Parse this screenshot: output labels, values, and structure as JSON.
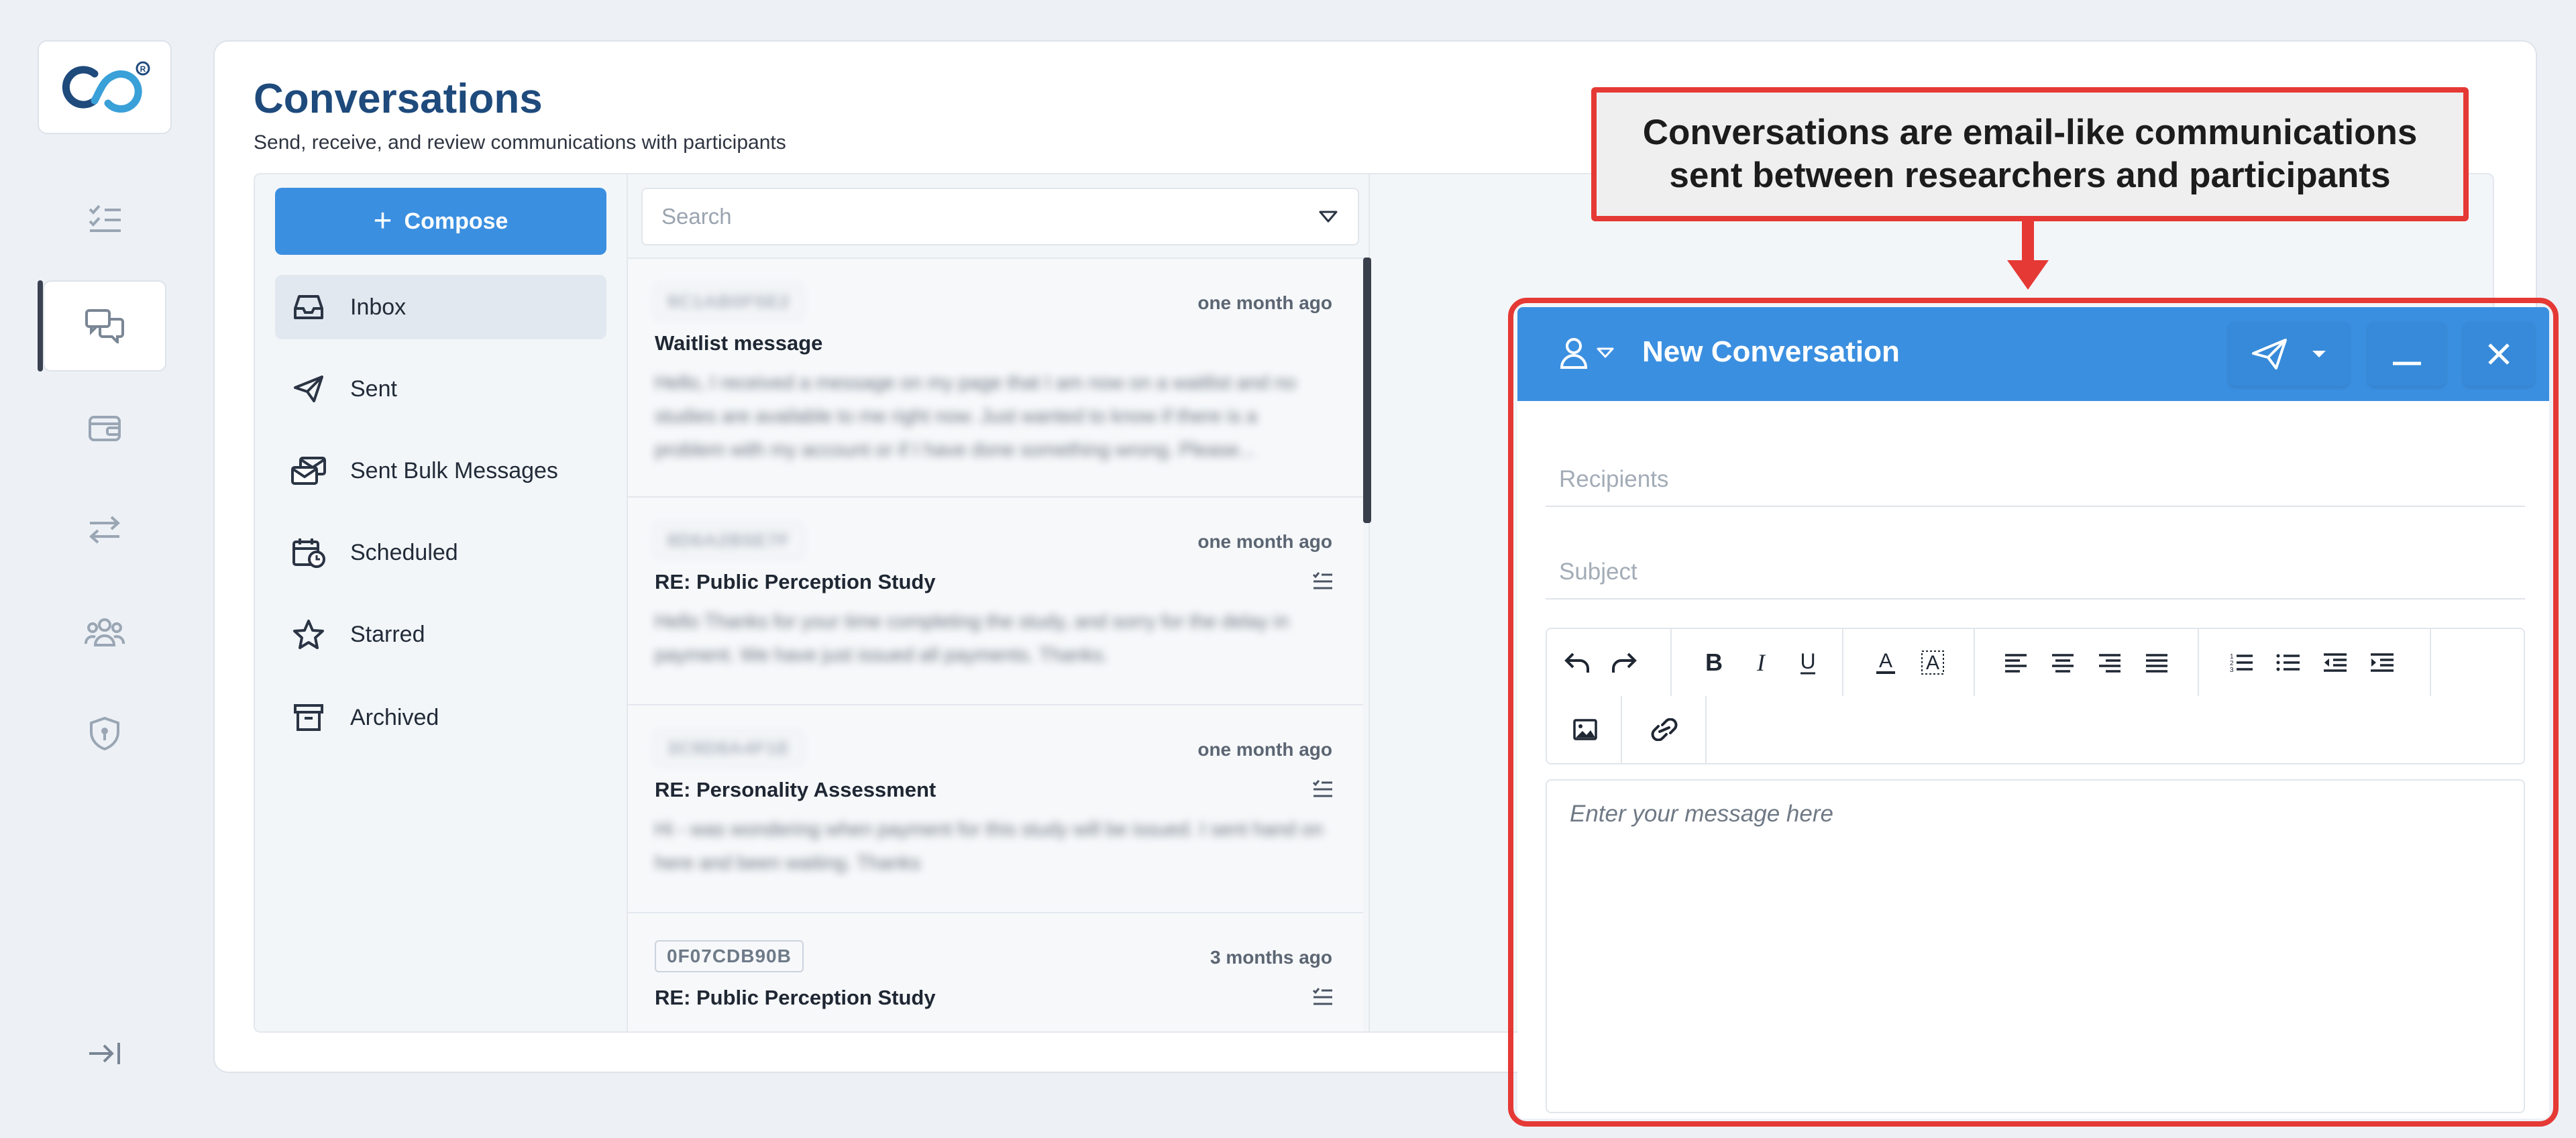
{
  "colors": {
    "accent": "#3b8fe0",
    "title": "#1e4a7c",
    "callout_border": "#e53935",
    "background": "#edf1f6"
  },
  "rail": {
    "items": [
      {
        "icon": "task-list-icon",
        "active": false
      },
      {
        "icon": "conversations-icon",
        "active": true
      },
      {
        "icon": "wallet-icon",
        "active": false
      },
      {
        "icon": "transfer-icon",
        "active": false
      },
      {
        "icon": "people-icon",
        "active": false
      },
      {
        "icon": "shield-icon",
        "active": false
      }
    ],
    "collapse_icon": "expand-sidebar-icon"
  },
  "header": {
    "title": "Conversations",
    "subtitle": "Send, receive, and review communications with participants"
  },
  "compose_button": {
    "label": "Compose"
  },
  "folders": [
    {
      "label": "Inbox",
      "icon": "inbox-icon",
      "active": true
    },
    {
      "label": "Sent",
      "icon": "paper-plane-icon",
      "active": false
    },
    {
      "label": "Sent Bulk Messages",
      "icon": "bulk-messages-icon",
      "active": false
    },
    {
      "label": "Scheduled",
      "icon": "calendar-clock-icon",
      "active": false
    },
    {
      "label": "Starred",
      "icon": "star-icon",
      "active": false
    },
    {
      "label": "Archived",
      "icon": "archive-icon",
      "active": false
    }
  ],
  "search": {
    "placeholder": "Search"
  },
  "messages": [
    {
      "id": "9C1AB0F5E2",
      "id_blurred": true,
      "time": "one month ago",
      "subject": "Waitlist message",
      "has_checklist": false,
      "preview": "Hello, I received a message on my page that I am now on a waitlist and no studies are available to me right now. Just wanted to know if there is a problem with my account or if I have done something wrong. Please..."
    },
    {
      "id": "8D6A2B5E7F",
      "id_blurred": true,
      "time": "one month ago",
      "subject": "RE: Public Perception Study",
      "has_checklist": true,
      "preview": "Hello Thanks for your time completing the study, and sorry for the delay in payment. We have just issued all payments. Thanks."
    },
    {
      "id": "3C9D8A4F1E",
      "id_blurred": true,
      "time": "one month ago",
      "subject": "RE: Personality Assessment",
      "has_checklist": true,
      "preview": "Hi - was wondering when payment for this study will be issued. I sent hand on here and been waiting. Thanks"
    },
    {
      "id": "0F07CDB90B",
      "id_blurred": false,
      "time": "3 months ago",
      "subject": "RE: Public Perception Study",
      "has_checklist": true,
      "preview": ""
    }
  ],
  "callout": {
    "text": "Conversations are email-like communications sent between researchers and participants"
  },
  "compose_window": {
    "title": "New Conversation",
    "recipients_placeholder": "Recipients",
    "subject_placeholder": "Subject",
    "body_placeholder": "Enter your message here",
    "toolbar": [
      "undo",
      "redo",
      "bold",
      "italic",
      "underline",
      "font-color",
      "highlight",
      "align-left",
      "align-center",
      "align-right",
      "justify",
      "ordered-list",
      "bullet-list",
      "outdent",
      "indent",
      "image",
      "link"
    ]
  }
}
